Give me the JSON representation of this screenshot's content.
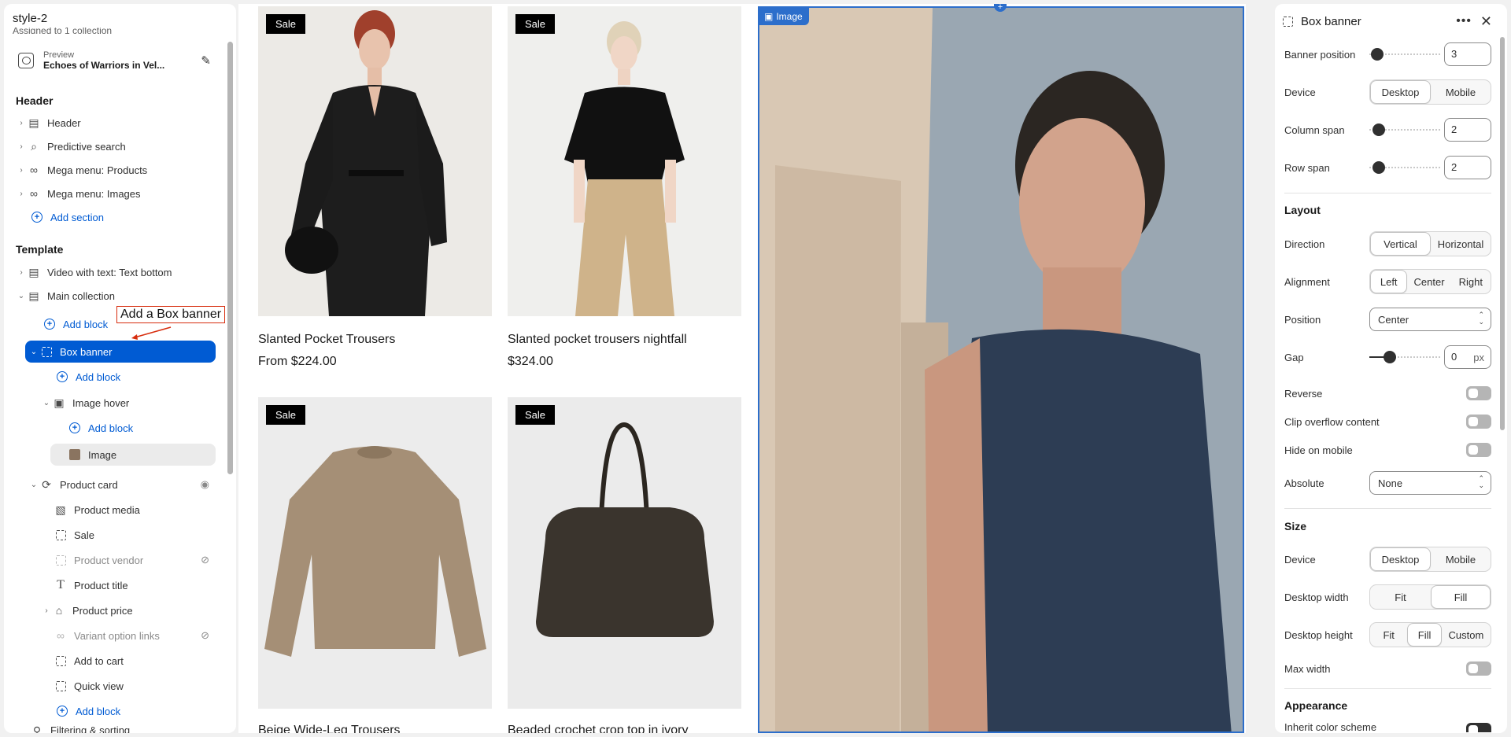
{
  "left": {
    "theme_name": "style-2",
    "assigned_text": "Assigned to 1 collection",
    "preview_label": "Preview",
    "preview_value": "Echoes of Warriors in Vel...",
    "header_section": "Header",
    "header_items": [
      "Header",
      "Predictive search",
      "Mega menu: Products",
      "Mega menu: Images"
    ],
    "add_section": "Add section",
    "template_section": "Template",
    "video_item": "Video with text: Text bottom",
    "main_collection": "Main collection",
    "add_block": "Add block",
    "box_banner": "Box banner",
    "image_hover": "Image hover",
    "image": "Image",
    "product_card": "Product card",
    "card_items": [
      "Product media",
      "Sale",
      "Product vendor",
      "Product title",
      "Product price",
      "Variant option links",
      "Add to cart",
      "Quick view"
    ],
    "filtering": "Filtering & sorting",
    "annotation": "Add a Box banner"
  },
  "canvas": {
    "sale_label": "Sale",
    "products": [
      {
        "title": "Slanted Pocket Trousers",
        "price": "From $224.00"
      },
      {
        "title": "Slanted pocket trousers nightfall",
        "price": "$324.00"
      },
      {
        "title": "Beige Wide-Leg Trousers",
        "price": ""
      },
      {
        "title": "Beaded crochet crop top in ivory",
        "price": ""
      }
    ],
    "banner_tag": "Image"
  },
  "right": {
    "title": "Box banner",
    "banner_position_label": "Banner position",
    "banner_position_value": "3",
    "device_label": "Device",
    "device_options": [
      "Desktop",
      "Mobile"
    ],
    "column_span_label": "Column span",
    "column_span_value": "2",
    "row_span_label": "Row span",
    "row_span_value": "2",
    "layout_heading": "Layout",
    "direction_label": "Direction",
    "direction_options": [
      "Vertical",
      "Horizontal"
    ],
    "alignment_label": "Alignment",
    "alignment_options": [
      "Left",
      "Center",
      "Right"
    ],
    "position_label": "Position",
    "position_value": "Center",
    "gap_label": "Gap",
    "gap_value": "0",
    "gap_unit": "px",
    "reverse_label": "Reverse",
    "clip_label": "Clip overflow content",
    "hide_mobile_label": "Hide on mobile",
    "absolute_label": "Absolute",
    "absolute_value": "None",
    "size_heading": "Size",
    "size_device_label": "Device",
    "desktop_width_label": "Desktop width",
    "width_options": [
      "Fit",
      "Fill"
    ],
    "desktop_height_label": "Desktop height",
    "height_options": [
      "Fit",
      "Fill",
      "Custom"
    ],
    "max_width_label": "Max width",
    "appearance_heading": "Appearance",
    "inherit_label": "Inherit color scheme"
  },
  "colors": {
    "accent": "#005bd3",
    "selection": "#2c6ecb",
    "badge": "#000000"
  }
}
